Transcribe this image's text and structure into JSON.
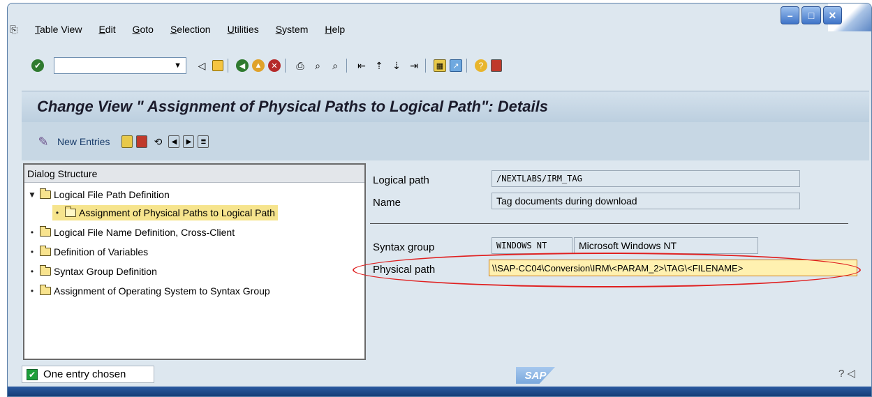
{
  "menu": {
    "items": [
      "Table View",
      "Edit",
      "Goto",
      "Selection",
      "Utilities",
      "System",
      "Help"
    ]
  },
  "toolbar": {
    "command_field_value": "",
    "icons": [
      "enter-icon",
      "back-icon",
      "save-icon",
      "back-green-icon",
      "exit-icon",
      "cancel-icon",
      "print-icon",
      "find-icon",
      "find-next-icon",
      "first-page-icon",
      "previous-page-icon",
      "next-page-icon",
      "last-page-icon",
      "create-session-icon",
      "shortcut-icon",
      "help-icon",
      "customize-layout-icon"
    ]
  },
  "page": {
    "title": "Change View \" Assignment of Physical Paths to Logical Path\": Details",
    "new_entries_label": "New Entries"
  },
  "dialog_structure": {
    "header": "Dialog Structure",
    "items": [
      {
        "label": "Logical File Path Definition",
        "level": 0,
        "expanded": true
      },
      {
        "label": "Assignment of Physical Paths to Logical Path",
        "level": 1,
        "selected": true
      },
      {
        "label": "Logical File Name Definition, Cross-Client",
        "level": 0
      },
      {
        "label": "Definition of Variables",
        "level": 0
      },
      {
        "label": "Syntax Group Definition",
        "level": 0
      },
      {
        "label": "Assignment of Operating System to Syntax Group",
        "level": 0
      }
    ]
  },
  "form": {
    "logical_path_label": "Logical path",
    "logical_path_value": "/NEXTLABS/IRM_TAG",
    "name_label": "Name",
    "name_value": "Tag documents during download",
    "syntax_group_label": "Syntax group",
    "syntax_group_code": "WINDOWS NT",
    "syntax_group_desc": "Microsoft Windows NT",
    "physical_path_label": "Physical path",
    "physical_path_value": "\\\\SAP-CC04\\Conversion\\IRM\\<PARAM_2>\\TAG\\<FILENAME>"
  },
  "status": {
    "message": "One entry chosen",
    "logo_text": "SAP"
  },
  "colors": {
    "window_bg": "#dde7ef",
    "selected_tree_item": "#f6e48d",
    "highlight_field": "#fff1b0",
    "annotation_ellipse": "#e02020"
  }
}
